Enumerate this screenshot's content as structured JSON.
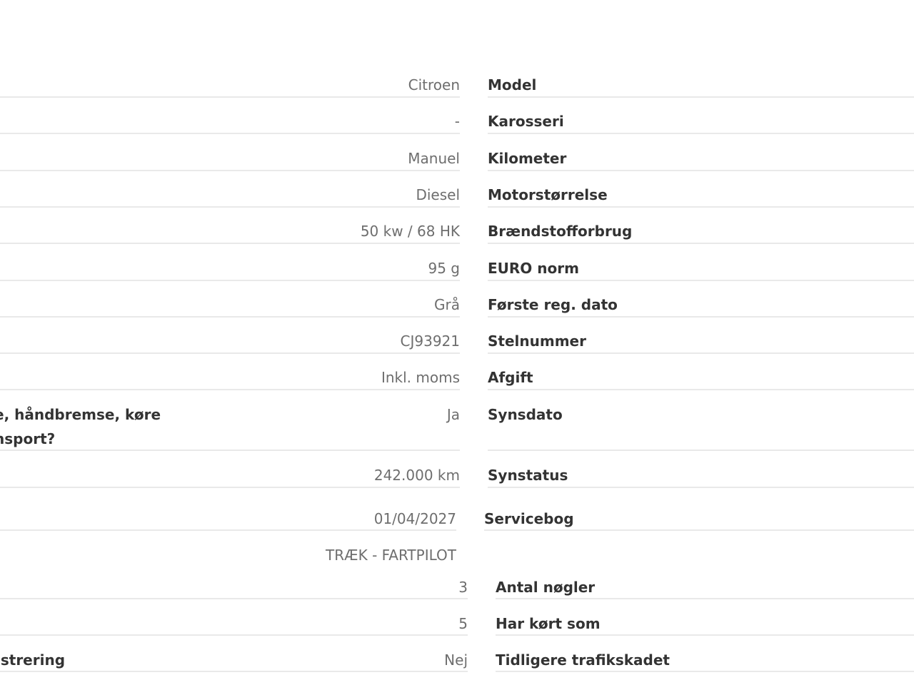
{
  "rows": [
    {
      "value": "Citroen",
      "label": "Model"
    },
    {
      "value": "-",
      "label": "Karosseri"
    },
    {
      "value": "Manuel",
      "label": "Kilometer"
    },
    {
      "value": "Diesel",
      "label": "Motorstørrelse"
    },
    {
      "value": "50 kw / 68 HK",
      "label": "Brændstofforbrug"
    },
    {
      "value": "95 g",
      "label": "EURO norm"
    },
    {
      "value": "Grå",
      "label": "Første reg. dato"
    },
    {
      "value": "CJ93921",
      "label": "Stelnummer"
    },
    {
      "value": "Inkl. moms",
      "label": "Afgift"
    },
    {
      "value": "Ja",
      "label": "Synsdato",
      "left_label_line1": "e, håndbremse, køre",
      "left_label_line2": "nsport?"
    },
    {
      "value": "242.000 km",
      "label": "Synstatus"
    },
    {
      "value": "01/04/2027",
      "label": "Servicebog"
    },
    {
      "value": "TRÆK - FARTPILOT",
      "label": "",
      "left_label_line1": ":"
    },
    {
      "value": "3",
      "label": "Antal nøgler"
    },
    {
      "value": "5",
      "label": "Har kørt som"
    },
    {
      "value": "Nej",
      "label": "Tidligere trafikskadet",
      "left_label_line1": "istrering"
    }
  ]
}
